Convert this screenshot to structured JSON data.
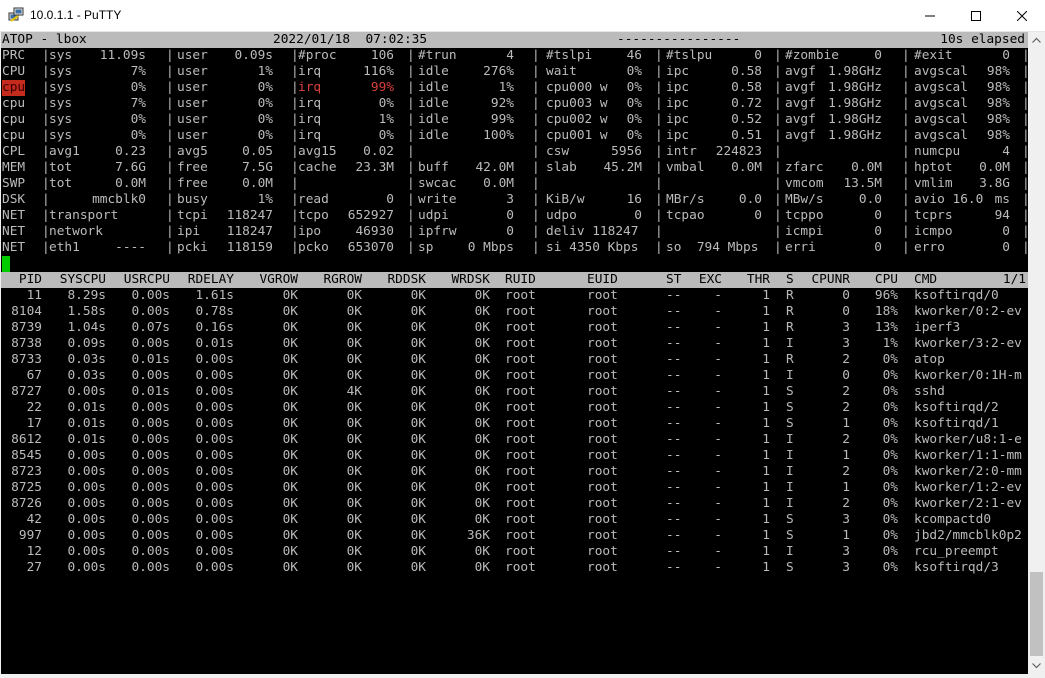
{
  "window": {
    "title": "10.0.1.1 - PuTTY",
    "minimize": "—",
    "maximize": "□",
    "close": "✕"
  },
  "header": {
    "left": "ATOP - lbox",
    "datetime": "2022/01/18  07:02:35",
    "dashes": "----------------",
    "elapsed": "10s elapsed"
  },
  "system_rows": [
    {
      "label": "PRC",
      "cells": [
        [
          "sys",
          "11.09s"
        ],
        [
          "user",
          "0.09s"
        ],
        [
          "#proc",
          "106"
        ],
        [
          "#trun",
          "4"
        ],
        [
          "#tslpi",
          "46"
        ],
        [
          "#tslpu",
          "0"
        ],
        [
          "#zombie",
          "0"
        ],
        [
          "#exit",
          "0"
        ]
      ]
    },
    {
      "label": "CPU",
      "cells": [
        [
          "sys",
          "7%"
        ],
        [
          "user",
          "1%"
        ],
        [
          "irq",
          "116%"
        ],
        [
          "idle",
          "276%"
        ],
        [
          "wait",
          "0%"
        ],
        [
          "ipc",
          "0.58"
        ],
        [
          "avgf",
          "1.98GHz"
        ],
        [
          "avgscal",
          "98%"
        ]
      ]
    },
    {
      "label": "cpu",
      "red": true,
      "cells": [
        [
          "sys",
          "0%"
        ],
        [
          "user",
          "0%"
        ],
        [
          "irq",
          "99%"
        ],
        [
          "idle",
          "1%"
        ],
        [
          "cpu000 w",
          "0%"
        ],
        [
          "ipc",
          "0.58"
        ],
        [
          "avgf",
          "1.98GHz"
        ],
        [
          "avgscal",
          "98%"
        ]
      ]
    },
    {
      "label": "cpu",
      "cells": [
        [
          "sys",
          "7%"
        ],
        [
          "user",
          "0%"
        ],
        [
          "irq",
          "0%"
        ],
        [
          "idle",
          "92%"
        ],
        [
          "cpu003 w",
          "0%"
        ],
        [
          "ipc",
          "0.72"
        ],
        [
          "avgf",
          "1.98GHz"
        ],
        [
          "avgscal",
          "98%"
        ]
      ]
    },
    {
      "label": "cpu",
      "cells": [
        [
          "sys",
          "0%"
        ],
        [
          "user",
          "0%"
        ],
        [
          "irq",
          "1%"
        ],
        [
          "idle",
          "99%"
        ],
        [
          "cpu002 w",
          "0%"
        ],
        [
          "ipc",
          "0.52"
        ],
        [
          "avgf",
          "1.98GHz"
        ],
        [
          "avgscal",
          "98%"
        ]
      ]
    },
    {
      "label": "cpu",
      "cells": [
        [
          "sys",
          "0%"
        ],
        [
          "user",
          "0%"
        ],
        [
          "irq",
          "0%"
        ],
        [
          "idle",
          "100%"
        ],
        [
          "cpu001 w",
          "0%"
        ],
        [
          "ipc",
          "0.51"
        ],
        [
          "avgf",
          "1.98GHz"
        ],
        [
          "avgscal",
          "98%"
        ]
      ]
    },
    {
      "label": "CPL",
      "cells": [
        [
          "avg1",
          "0.23"
        ],
        [
          "avg5",
          "0.05"
        ],
        [
          "avg15",
          "0.02"
        ],
        [
          "",
          ""
        ],
        [
          "csw",
          "5956"
        ],
        [
          "intr",
          "224823"
        ],
        [
          "",
          ""
        ],
        [
          "numcpu",
          "4"
        ]
      ]
    },
    {
      "label": "MEM",
      "cells": [
        [
          "tot",
          "7.6G"
        ],
        [
          "free",
          "7.5G"
        ],
        [
          "cache",
          "23.3M"
        ],
        [
          "buff",
          "42.0M"
        ],
        [
          "slab",
          "45.2M"
        ],
        [
          "vmbal",
          "0.0M"
        ],
        [
          "zfarc",
          "0.0M"
        ],
        [
          "hptot",
          "0.0M"
        ]
      ]
    },
    {
      "label": "SWP",
      "cells": [
        [
          "tot",
          "0.0M"
        ],
        [
          "free",
          "0.0M"
        ],
        [
          "",
          ""
        ],
        [
          "swcac",
          "0.0M"
        ],
        [
          "",
          ""
        ],
        [
          "",
          ""
        ],
        [
          "vmcom",
          "13.5M"
        ],
        [
          "vmlim",
          "3.8G"
        ]
      ]
    },
    {
      "label": "DSK",
      "cells": [
        [
          "",
          "mmcblk0"
        ],
        [
          "busy",
          "1%"
        ],
        [
          "read",
          "0"
        ],
        [
          "write",
          "3"
        ],
        [
          "KiB/w",
          "16"
        ],
        [
          "MBr/s",
          "0.0"
        ],
        [
          "MBw/s",
          "0.0"
        ],
        [
          "avio 16.0",
          "ms"
        ]
      ]
    },
    {
      "label": "NET",
      "cells": [
        [
          "transport",
          ""
        ],
        [
          "tcpi",
          "118247"
        ],
        [
          "tcpo",
          "652927"
        ],
        [
          "udpi",
          "0"
        ],
        [
          "udpo",
          "0"
        ],
        [
          "tcpao",
          "0"
        ],
        [
          "tcppo",
          "0"
        ],
        [
          "tcprs",
          "94"
        ]
      ]
    },
    {
      "label": "NET",
      "cells": [
        [
          "network",
          ""
        ],
        [
          "ipi",
          "118247"
        ],
        [
          "ipo",
          "46930"
        ],
        [
          "ipfrw",
          "0"
        ],
        [
          "deliv 118247",
          ""
        ],
        [
          "",
          ""
        ],
        [
          "icmpi",
          "0"
        ],
        [
          "icmpo",
          "0"
        ]
      ]
    },
    {
      "label": "NET",
      "cells": [
        [
          "eth1",
          "----"
        ],
        [
          "pcki",
          "118159"
        ],
        [
          "pcko",
          "653070"
        ],
        [
          "sp",
          "0 Mbps"
        ],
        [
          "si 4350 Kbps",
          ""
        ],
        [
          "so  794 Mbps",
          ""
        ],
        [
          "erri",
          "0"
        ],
        [
          "erro",
          "0"
        ]
      ]
    }
  ],
  "process_header": [
    "PID",
    "SYSCPU",
    "USRCPU",
    "RDELAY",
    "VGROW",
    "RGROW",
    "RDDSK",
    "WRDSK",
    "RUID",
    "EUID",
    "ST",
    "EXC",
    "THR",
    "S",
    "CPUNR",
    "CPU",
    "CMD",
    "1/1"
  ],
  "processes": [
    [
      "11",
      "8.29s",
      "0.00s",
      "1.61s",
      "0K",
      "0K",
      "0K",
      "0K",
      "root",
      "root",
      "--",
      "-",
      "1",
      "R",
      "0",
      "96%",
      "ksoftirqd/0"
    ],
    [
      "8104",
      "1.58s",
      "0.00s",
      "0.78s",
      "0K",
      "0K",
      "0K",
      "0K",
      "root",
      "root",
      "--",
      "-",
      "1",
      "R",
      "0",
      "18%",
      "kworker/0:2-ev"
    ],
    [
      "8739",
      "1.04s",
      "0.07s",
      "0.16s",
      "0K",
      "0K",
      "0K",
      "0K",
      "root",
      "root",
      "--",
      "-",
      "1",
      "R",
      "3",
      "13%",
      "iperf3"
    ],
    [
      "8738",
      "0.09s",
      "0.00s",
      "0.01s",
      "0K",
      "0K",
      "0K",
      "0K",
      "root",
      "root",
      "--",
      "-",
      "1",
      "I",
      "3",
      "1%",
      "kworker/3:2-ev"
    ],
    [
      "8733",
      "0.03s",
      "0.01s",
      "0.00s",
      "0K",
      "0K",
      "0K",
      "0K",
      "root",
      "root",
      "--",
      "-",
      "1",
      "R",
      "2",
      "0%",
      "atop"
    ],
    [
      "67",
      "0.03s",
      "0.00s",
      "0.00s",
      "0K",
      "0K",
      "0K",
      "0K",
      "root",
      "root",
      "--",
      "-",
      "1",
      "I",
      "0",
      "0%",
      "kworker/0:1H-m"
    ],
    [
      "8727",
      "0.00s",
      "0.01s",
      "0.00s",
      "0K",
      "4K",
      "0K",
      "0K",
      "root",
      "root",
      "--",
      "-",
      "1",
      "S",
      "2",
      "0%",
      "sshd"
    ],
    [
      "22",
      "0.01s",
      "0.00s",
      "0.00s",
      "0K",
      "0K",
      "0K",
      "0K",
      "root",
      "root",
      "--",
      "-",
      "1",
      "S",
      "2",
      "0%",
      "ksoftirqd/2"
    ],
    [
      "17",
      "0.01s",
      "0.00s",
      "0.00s",
      "0K",
      "0K",
      "0K",
      "0K",
      "root",
      "root",
      "--",
      "-",
      "1",
      "S",
      "1",
      "0%",
      "ksoftirqd/1"
    ],
    [
      "8612",
      "0.01s",
      "0.00s",
      "0.00s",
      "0K",
      "0K",
      "0K",
      "0K",
      "root",
      "root",
      "--",
      "-",
      "1",
      "I",
      "2",
      "0%",
      "kworker/u8:1-e"
    ],
    [
      "8545",
      "0.00s",
      "0.00s",
      "0.00s",
      "0K",
      "0K",
      "0K",
      "0K",
      "root",
      "root",
      "--",
      "-",
      "1",
      "I",
      "1",
      "0%",
      "kworker/1:1-mm"
    ],
    [
      "8723",
      "0.00s",
      "0.00s",
      "0.00s",
      "0K",
      "0K",
      "0K",
      "0K",
      "root",
      "root",
      "--",
      "-",
      "1",
      "I",
      "2",
      "0%",
      "kworker/2:0-mm"
    ],
    [
      "8725",
      "0.00s",
      "0.00s",
      "0.00s",
      "0K",
      "0K",
      "0K",
      "0K",
      "root",
      "root",
      "--",
      "-",
      "1",
      "I",
      "1",
      "0%",
      "kworker/1:2-ev"
    ],
    [
      "8726",
      "0.00s",
      "0.00s",
      "0.00s",
      "0K",
      "0K",
      "0K",
      "0K",
      "root",
      "root",
      "--",
      "-",
      "1",
      "I",
      "2",
      "0%",
      "kworker/2:1-ev"
    ],
    [
      "42",
      "0.00s",
      "0.00s",
      "0.00s",
      "0K",
      "0K",
      "0K",
      "0K",
      "root",
      "root",
      "--",
      "-",
      "1",
      "S",
      "3",
      "0%",
      "kcompactd0"
    ],
    [
      "997",
      "0.00s",
      "0.00s",
      "0.00s",
      "0K",
      "0K",
      "0K",
      "36K",
      "root",
      "root",
      "--",
      "-",
      "1",
      "S",
      "1",
      "0%",
      "jbd2/mmcblk0p2"
    ],
    [
      "12",
      "0.00s",
      "0.00s",
      "0.00s",
      "0K",
      "0K",
      "0K",
      "0K",
      "root",
      "root",
      "--",
      "-",
      "1",
      "I",
      "3",
      "0%",
      "rcu_preempt"
    ],
    [
      "27",
      "0.00s",
      "0.00s",
      "0.00s",
      "0K",
      "0K",
      "0K",
      "0K",
      "root",
      "root",
      "--",
      "-",
      "1",
      "S",
      "3",
      "0%",
      "ksoftirqd/3"
    ]
  ],
  "colors": {
    "terminal_bg": "#000000",
    "terminal_fg": "#bbbbbb",
    "alert_red": "#d8403c",
    "cursor_green": "#00cc00"
  },
  "icons": {
    "app": "putty-icon",
    "scroll_up": "scroll-up-arrow-icon",
    "scroll_down": "scroll-down-arrow-icon"
  }
}
